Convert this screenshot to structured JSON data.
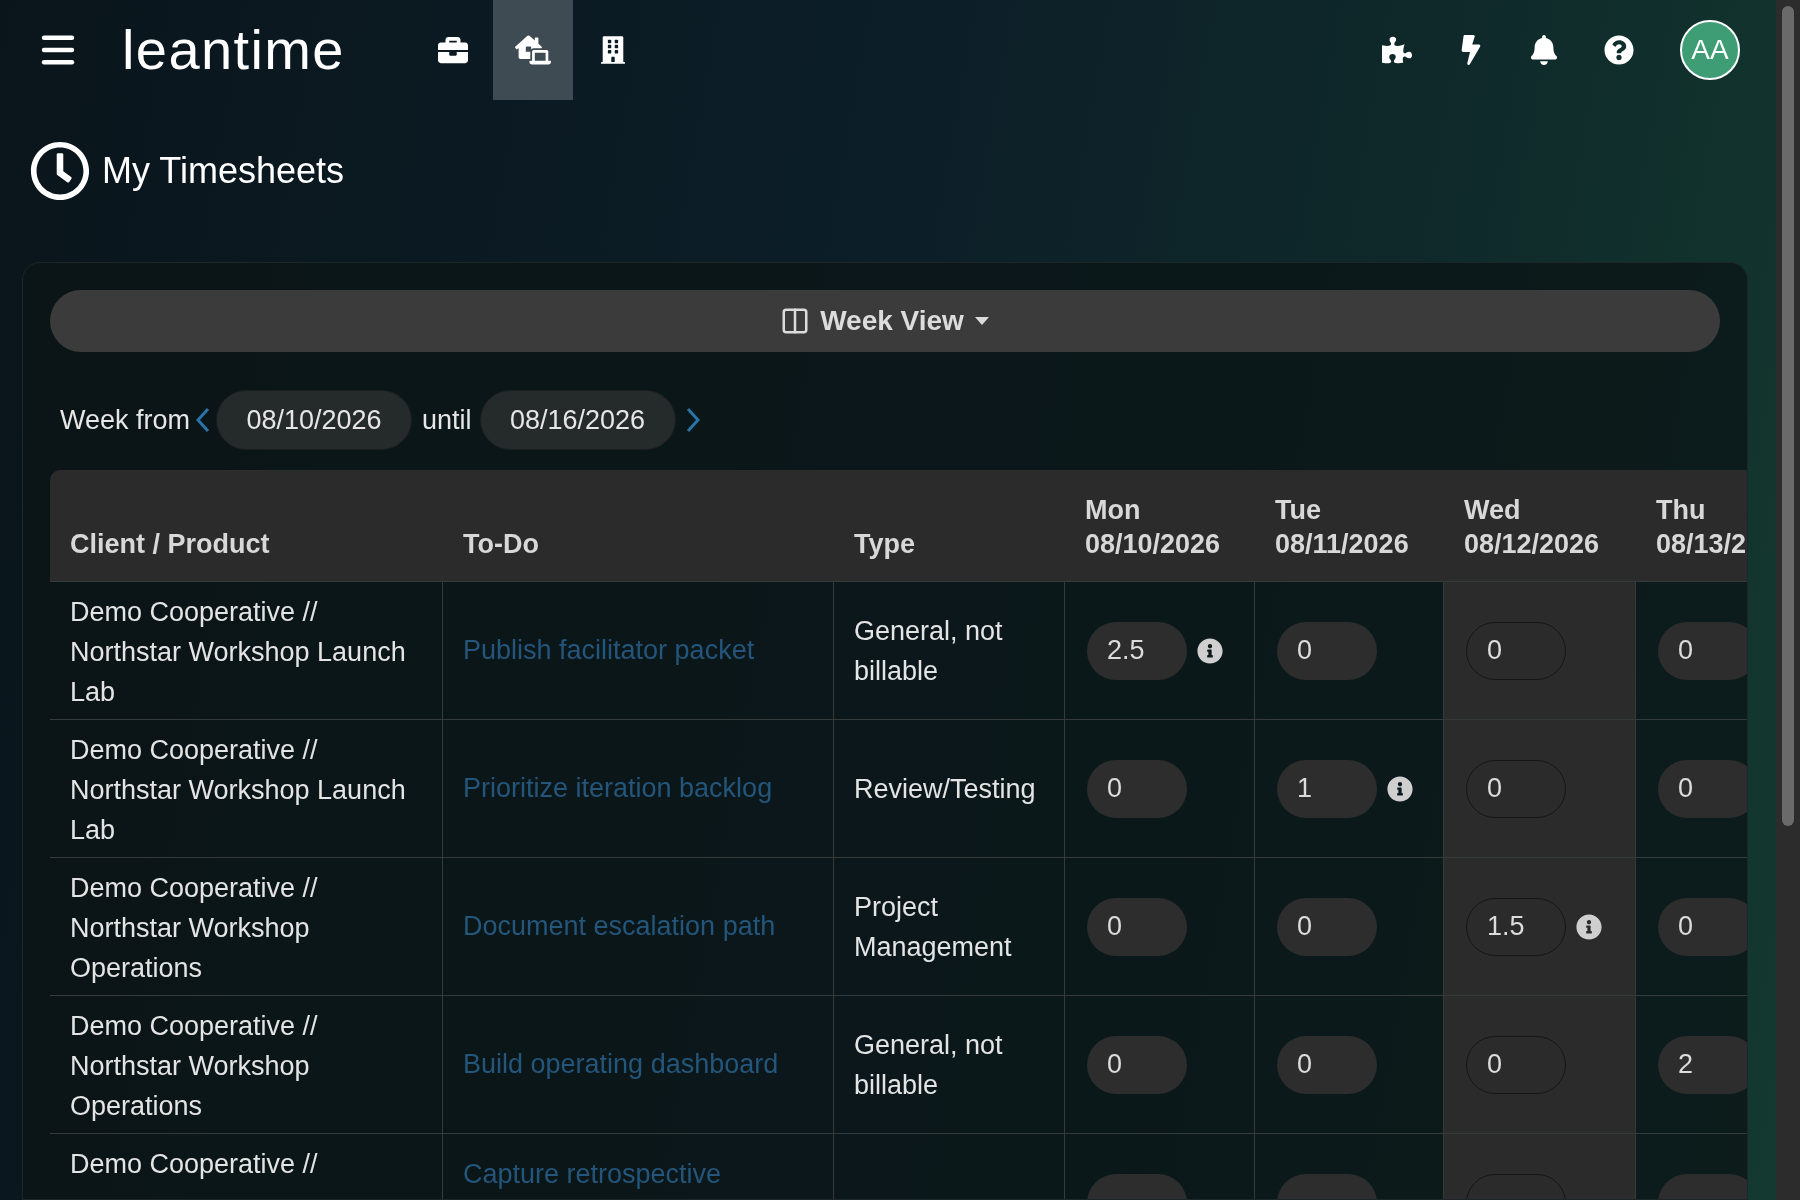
{
  "topbar": {
    "logo": "leantime",
    "nav_icons": [
      {
        "kind": "briefcase",
        "selected": false
      },
      {
        "kind": "home-office",
        "selected": true
      },
      {
        "kind": "building",
        "selected": false
      }
    ],
    "avatar": "AA"
  },
  "page_title": "My Timesheets",
  "view_switch": {
    "label": "Week View"
  },
  "week": {
    "from_label": "Week from",
    "from": "08/10/2026",
    "until_label": "until",
    "until": "08/16/2026"
  },
  "table": {
    "columns": [
      {
        "kind": "text",
        "label": "Client / Product"
      },
      {
        "kind": "text",
        "label": "To-Do"
      },
      {
        "kind": "text",
        "label": "Type"
      },
      {
        "kind": "day",
        "day": "Mon",
        "date": "08/10/2026",
        "selected": false
      },
      {
        "kind": "day",
        "day": "Tue",
        "date": "08/11/2026",
        "selected": false
      },
      {
        "kind": "day",
        "day": "Wed",
        "date": "08/12/2026",
        "selected": true
      },
      {
        "kind": "day",
        "day": "Thu",
        "date": "08/13/2",
        "selected": false
      }
    ],
    "rows": [
      {
        "client": "Demo Cooperative // Northstar Workshop Launch Lab",
        "todo": "Publish facilitator packet",
        "type": "General, not billable",
        "hours": [
          {
            "value": "2.5",
            "info": true
          },
          {
            "value": "0",
            "info": false
          },
          {
            "value": "0",
            "info": false
          },
          {
            "value": "0"
          }
        ]
      },
      {
        "client": "Demo Cooperative // Northstar Workshop Launch Lab",
        "todo": "Prioritize iteration backlog",
        "type": "Review/Testing",
        "hours": [
          {
            "value": "0",
            "info": false
          },
          {
            "value": "1",
            "info": true
          },
          {
            "value": "0",
            "info": false
          },
          {
            "value": "0"
          }
        ]
      },
      {
        "client": "Demo Cooperative // Northstar Workshop Operations",
        "todo": "Document escalation path",
        "type": "Project Management",
        "hours": [
          {
            "value": "0",
            "info": false
          },
          {
            "value": "0",
            "info": false
          },
          {
            "value": "1.5",
            "info": true
          },
          {
            "value": "0"
          }
        ]
      },
      {
        "client": "Demo Cooperative // Northstar Workshop Operations",
        "todo": "Build operating dashboard",
        "type": "General, not billable",
        "hours": [
          {
            "value": "0",
            "info": false
          },
          {
            "value": "0",
            "info": false
          },
          {
            "value": "0",
            "info": false
          },
          {
            "value": "2"
          }
        ]
      },
      {
        "client": "Demo Cooperative //",
        "todo": "Capture retrospective",
        "hours": [
          {
            "info": false
          },
          {
            "info": false
          },
          {
            "info": false
          }
        ]
      }
    ]
  }
}
